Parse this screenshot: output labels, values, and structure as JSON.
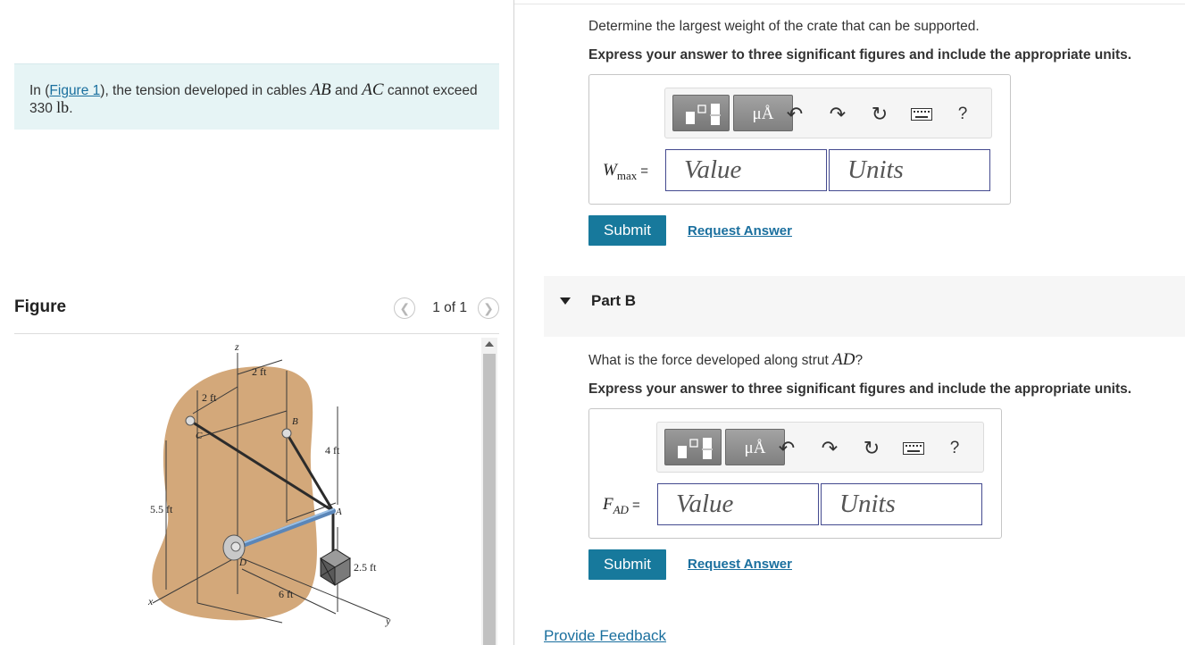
{
  "problem": {
    "prefix": "In (",
    "figure_link": "Figure 1",
    "middle": "), the tension developed in cables ",
    "cable1": "AB",
    "and": " and ",
    "cable2": "AC",
    "suffix": " cannot exceed 330 ",
    "unit": "lb",
    "end": "."
  },
  "figure": {
    "title": "Figure",
    "pager_text": "1 of 1",
    "labels": {
      "z": "z",
      "x": "x",
      "y": "y",
      "two_ft_top": "2 ft",
      "two_ft_left": "2 ft",
      "four_ft": "4 ft",
      "five_five_ft": "5.5 ft",
      "two_five_ft": "2.5 ft",
      "six_ft": "6 ft",
      "pt_a": "A",
      "pt_b": "B",
      "pt_c": "C",
      "pt_d": "D"
    }
  },
  "partA": {
    "question": "Determine the largest weight of the crate that can be supported.",
    "instruction": "Express your answer to three significant figures and include the appropriate units.",
    "var_main": "W",
    "var_sub": "max",
    "equals": "=",
    "value_placeholder": "Value",
    "units_placeholder": "Units",
    "submit": "Submit",
    "request": "Request Answer"
  },
  "partB": {
    "header": "Part B",
    "question_prefix": "What is the force developed along strut ",
    "strut": "AD",
    "question_suffix": "?",
    "instruction": "Express your answer to three significant figures and include the appropriate units.",
    "var_main": "F",
    "var_sub": "AD",
    "equals": "=",
    "value_placeholder": "Value",
    "units_placeholder": "Units",
    "submit": "Submit",
    "request": "Request Answer"
  },
  "toolbar": {
    "units_glyph": "μÅ",
    "help": "?"
  },
  "footer": {
    "feedback": "Provide Feedback"
  },
  "colors": {
    "submit_bg": "#17799c",
    "link": "#1a6f9e",
    "problem_bg": "#e6f4f5",
    "input_border": "#444a8f"
  }
}
